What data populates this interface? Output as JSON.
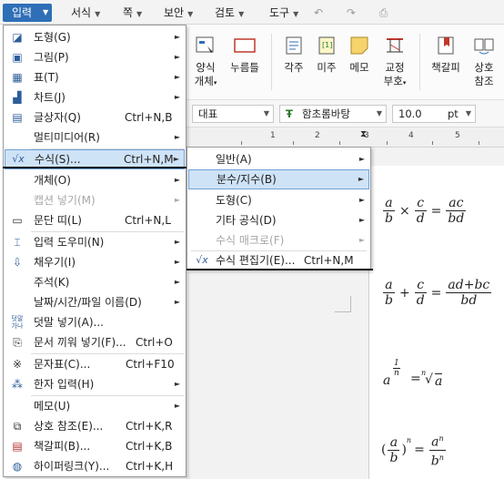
{
  "menubar": {
    "active_label": "입력",
    "items": [
      {
        "label": "서식"
      },
      {
        "label": "쪽"
      },
      {
        "label": "보안"
      },
      {
        "label": "검토"
      },
      {
        "label": "도구"
      }
    ]
  },
  "toolbar": {
    "buttons": [
      {
        "label1": "양식",
        "label2": "개체",
        "icon": "form-object-icon"
      },
      {
        "label1": "누름틀",
        "label2": "",
        "icon": "click-field-icon"
      },
      {
        "label1": "각주",
        "label2": "",
        "icon": "footnote-icon"
      },
      {
        "label1": "미주",
        "label2": "",
        "icon": "endnote-icon"
      },
      {
        "label1": "메모",
        "label2": "",
        "icon": "memo-icon"
      },
      {
        "label1": "교정",
        "label2": "부호",
        "icon": "proofreading-icon"
      },
      {
        "label1": "책갈피",
        "label2": "",
        "icon": "bookmark-icon"
      },
      {
        "label1": "상호",
        "label2": "참조",
        "icon": "cross-reference-icon"
      }
    ]
  },
  "format": {
    "style": "대표",
    "font": "함초롬바탕",
    "size": "10.0",
    "unit": "pt"
  },
  "ruler": {
    "marks": [
      "1",
      "2",
      "3",
      "4",
      "5"
    ]
  },
  "menu_insert": {
    "items": [
      {
        "icon": "shape-icon",
        "label": "도형(G)",
        "shortcut": "",
        "sub": true
      },
      {
        "icon": "picture-icon",
        "label": "그림(P)",
        "shortcut": "",
        "sub": true
      },
      {
        "icon": "table-icon",
        "label": "표(T)",
        "shortcut": "",
        "sub": true
      },
      {
        "icon": "chart-icon",
        "label": "차트(J)",
        "shortcut": "",
        "sub": true
      },
      {
        "icon": "textbox-icon",
        "label": "글상자(Q)",
        "shortcut": "Ctrl+N,B",
        "sub": false
      },
      {
        "icon": "",
        "label": "멀티미디어(R)",
        "shortcut": "",
        "sub": true
      },
      {
        "icon": "equation-icon",
        "label": "수식(S)...",
        "shortcut": "Ctrl+N,M",
        "sub": true
      },
      {
        "icon": "",
        "label": "개체(O)",
        "shortcut": "",
        "sub": true
      },
      {
        "icon": "",
        "label": "캡션 넣기(M)",
        "shortcut": "",
        "sub": true
      },
      {
        "icon": "paragraph-band-icon",
        "label": "문단 띠(L)",
        "shortcut": "Ctrl+N,L",
        "sub": false
      },
      {
        "icon": "input-helper-icon",
        "label": "입력 도우미(N)",
        "shortcut": "",
        "sub": true
      },
      {
        "icon": "fill-icon",
        "label": "채우기(I)",
        "shortcut": "",
        "sub": true
      },
      {
        "icon": "",
        "label": "주석(K)",
        "shortcut": "",
        "sub": true
      },
      {
        "icon": "",
        "label": "날짜/시간/파일 이름(D)",
        "shortcut": "",
        "sub": true
      },
      {
        "icon": "overlap-text-icon",
        "label": "덧말 넣기(A)...",
        "shortcut": "",
        "sub": false
      },
      {
        "icon": "insert-document-icon",
        "label": "문서 끼워 넣기(F)...",
        "shortcut": "Ctrl+O",
        "sub": false
      },
      {
        "icon": "character-map-icon",
        "label": "문자표(C)...",
        "shortcut": "Ctrl+F10",
        "sub": false
      },
      {
        "icon": "hanja-icon",
        "label": "한자 입력(H)",
        "shortcut": "",
        "sub": true
      },
      {
        "icon": "",
        "label": "메모(U)",
        "shortcut": "",
        "sub": true
      },
      {
        "icon": "cross-reference-icon",
        "label": "상호 참조(E)...",
        "shortcut": "Ctrl+K,R",
        "sub": false
      },
      {
        "icon": "bookmark-icon",
        "label": "책갈피(B)...",
        "shortcut": "Ctrl+K,B",
        "sub": false
      },
      {
        "icon": "hyperlink-icon",
        "label": "하이퍼링크(Y)...",
        "shortcut": "Ctrl+K,H",
        "sub": false
      }
    ],
    "icon_glyphs": {
      "eq_small": "√x",
      "ctx": "덧말",
      "ctx2": "가나"
    }
  },
  "menu_equation": {
    "items": [
      {
        "label": "일반(A)",
        "shortcut": "",
        "sub": true
      },
      {
        "label": "분수/지수(B)",
        "shortcut": "",
        "sub": true
      },
      {
        "label": "도형(C)",
        "shortcut": "",
        "sub": true
      },
      {
        "label": "기타 공식(D)",
        "shortcut": "",
        "sub": true
      },
      {
        "label": "수식 매크로(F)",
        "shortcut": "",
        "sub": true
      },
      {
        "label": "수식 편집기(E)...",
        "shortcut": "Ctrl+N,M",
        "sub": false
      }
    ]
  },
  "formulas": {
    "f1": {
      "a": "a",
      "b": "b",
      "c": "c",
      "d": "d",
      "ac": "ac",
      "bd": "bd",
      "times": "×",
      "eq": "="
    },
    "f2": {
      "a": "a",
      "b": "b",
      "c": "c",
      "d": "d",
      "num": "ad+bc",
      "den": "bd",
      "plus": "+",
      "eq": "="
    },
    "f3": {
      "base": "a",
      "one": "1",
      "n": "n",
      "eq": "=",
      "root_index": "n",
      "radicand": "a",
      "radical": "√"
    },
    "f4": {
      "a": "a",
      "b": "b",
      "n": "n",
      "eq": "=",
      "lp": "(",
      "rp": ")"
    }
  },
  "colors": {
    "accent": "#2f6fb7",
    "highlight": "#cfe3f7",
    "highlight_border": "#6ea1d6"
  }
}
